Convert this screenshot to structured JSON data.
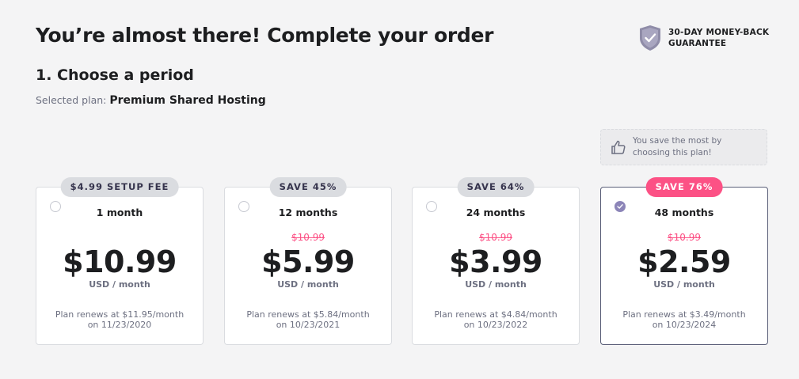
{
  "header": {
    "title": "You’re almost there! Complete your order",
    "guarantee_line1": "30-DAY MONEY-BACK",
    "guarantee_line2": "GUARANTEE",
    "guarantee_icon": "shield-check-icon"
  },
  "step": {
    "title": "1. Choose a period",
    "selected_label": "Selected plan:",
    "selected_value": "Premium Shared Hosting"
  },
  "tip": {
    "icon": "thumbs-up-icon",
    "line1": "You save the most by",
    "line2": "choosing this plan!"
  },
  "colors": {
    "accent_pink": "#fc5185",
    "selected_border": "#5a5f78",
    "text_dark": "#1d1e20",
    "text_muted": "#6d7081"
  },
  "plans": [
    {
      "badge": "$4.99 SETUP FEE",
      "period": "1 month",
      "old_price": "",
      "price": "$10.99",
      "unit": "USD / month",
      "renew_line1": "Plan renews at $11.95/month",
      "renew_line2": "on 11/23/2020",
      "selected": false
    },
    {
      "badge": "SAVE 45%",
      "period": "12 months",
      "old_price": "$10.99",
      "price": "$5.99",
      "unit": "USD / month",
      "renew_line1": "Plan renews at $5.84/month",
      "renew_line2": "on 10/23/2021",
      "selected": false
    },
    {
      "badge": "SAVE 64%",
      "period": "24 months",
      "old_price": "$10.99",
      "price": "$3.99",
      "unit": "USD / month",
      "renew_line1": "Plan renews at $4.84/month",
      "renew_line2": "on 10/23/2022",
      "selected": false
    },
    {
      "badge": "SAVE 76%",
      "period": "48 months",
      "old_price": "$10.99",
      "price": "$2.59",
      "unit": "USD / month",
      "renew_line1": "Plan renews at $3.49/month",
      "renew_line2": "on 10/23/2024",
      "selected": true
    }
  ]
}
